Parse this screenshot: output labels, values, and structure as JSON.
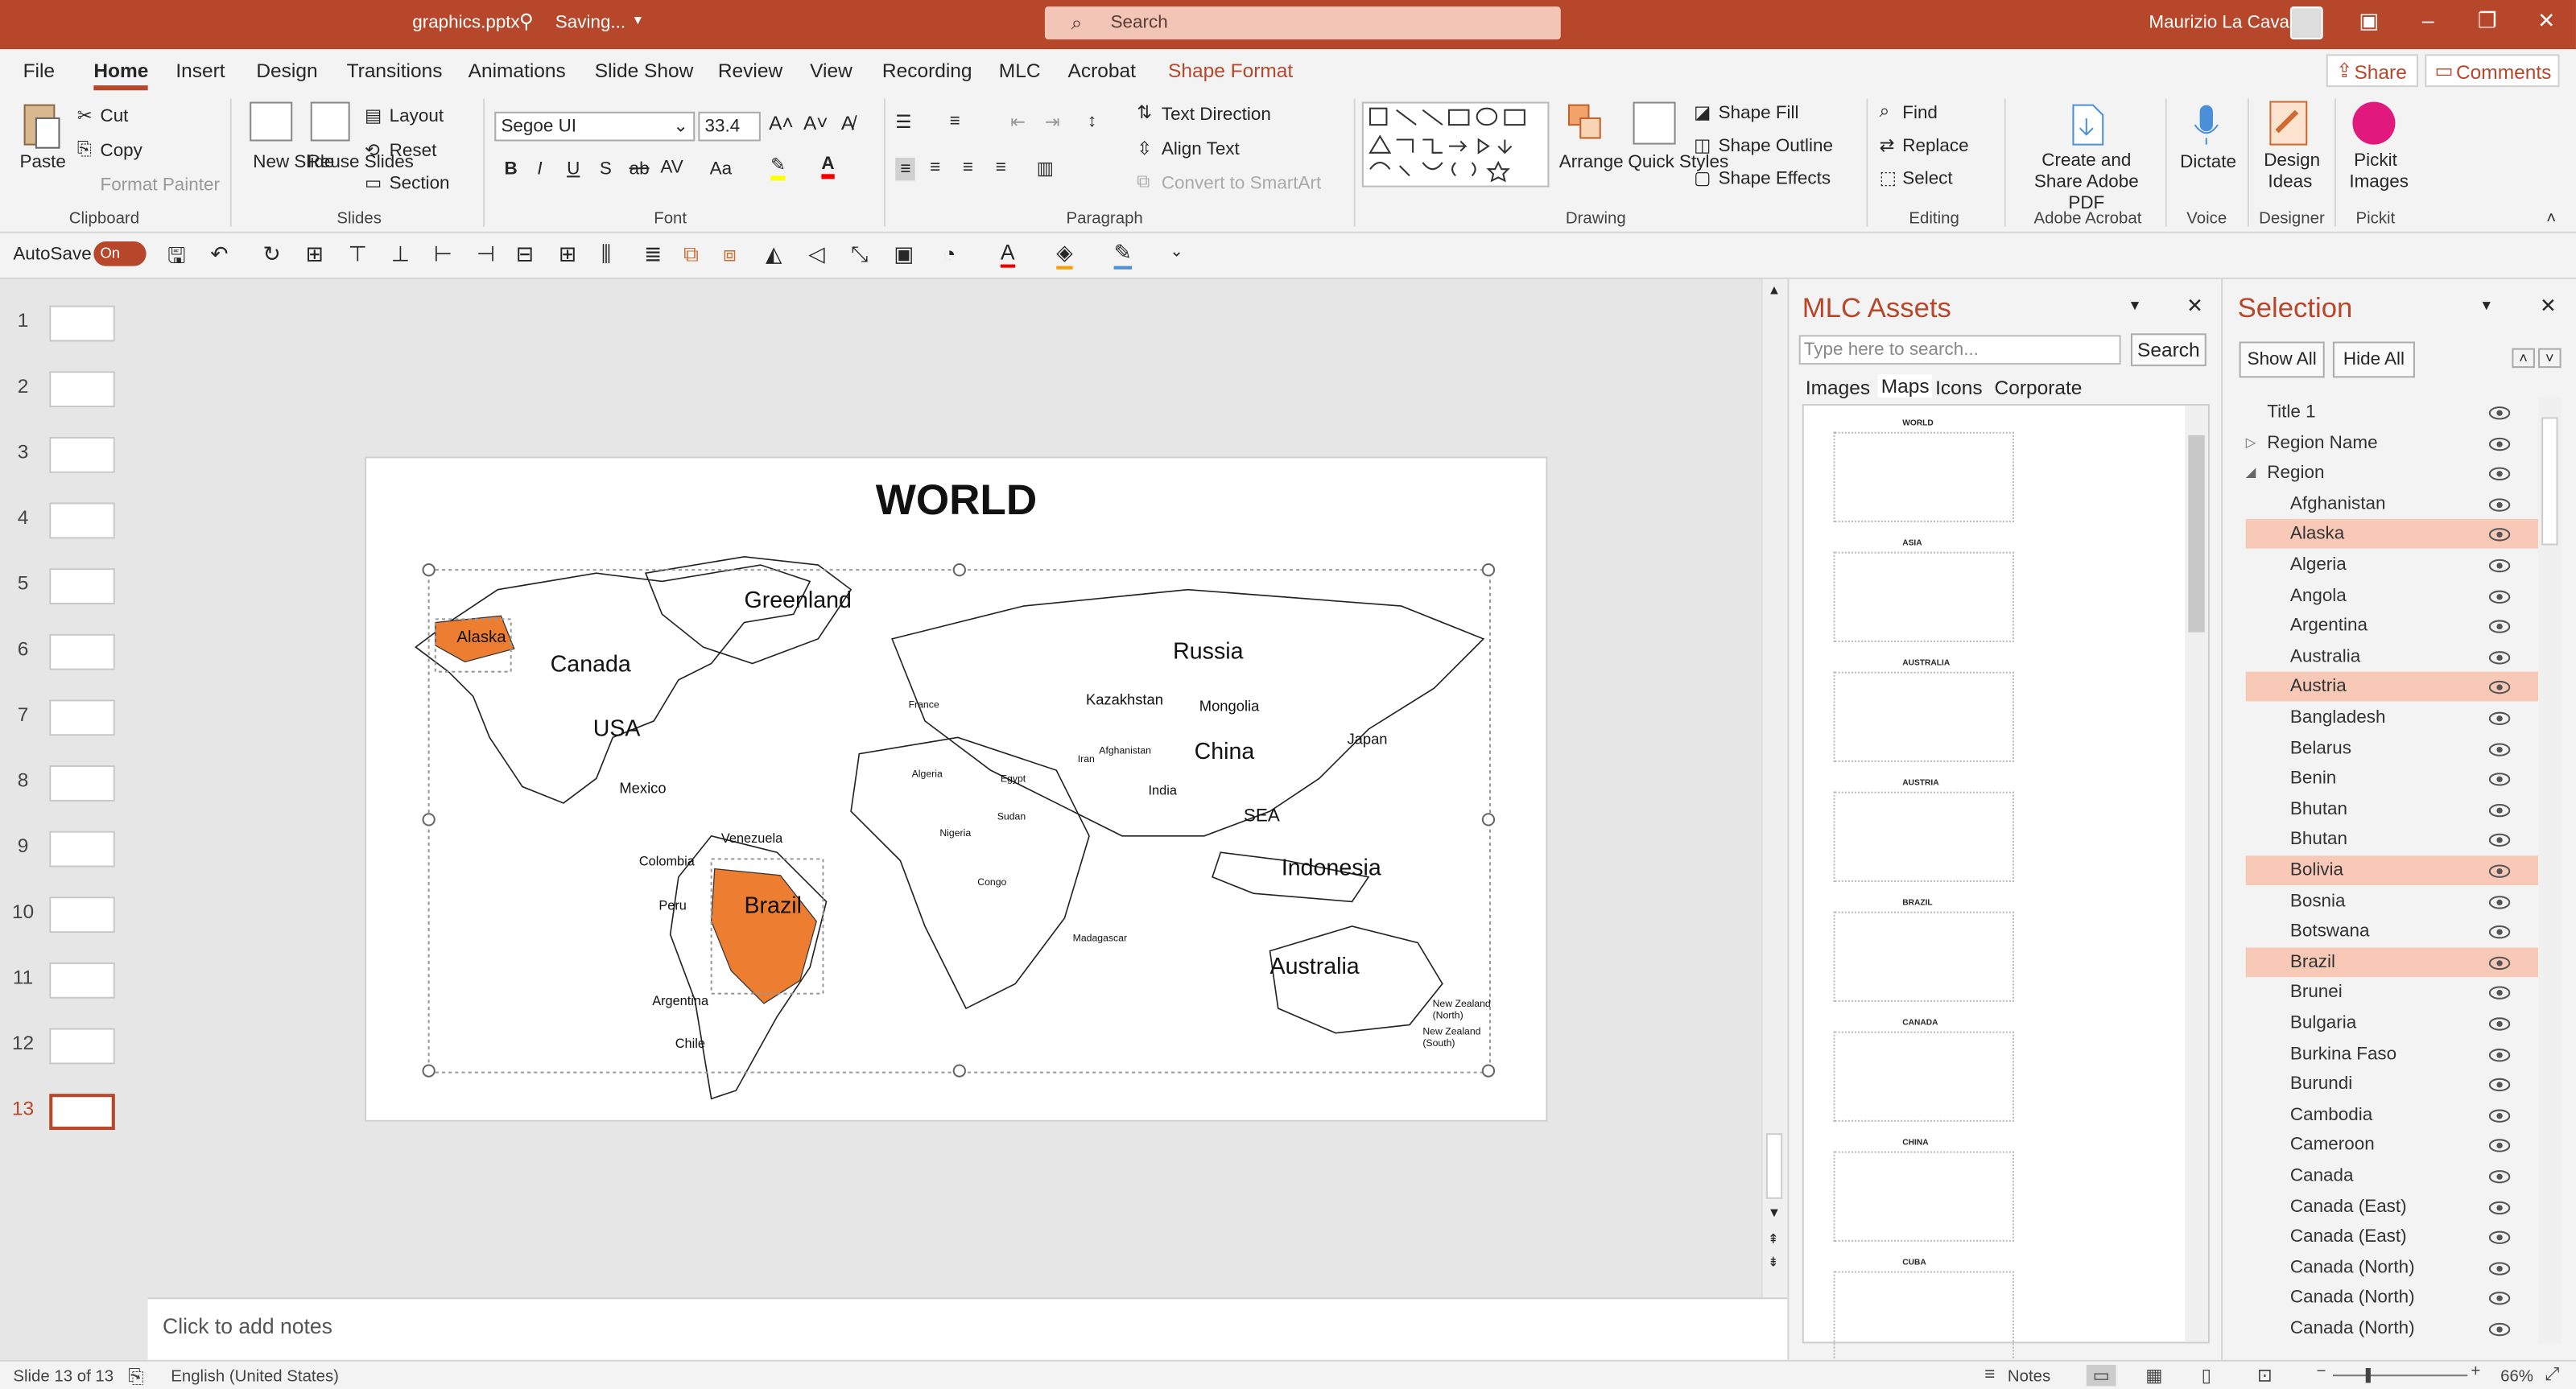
{
  "titlebar": {
    "filename": "graphics.pptx",
    "status": "Saving...",
    "search_placeholder": "Search",
    "user": "Maurizio La Cava"
  },
  "menu": {
    "tabs": [
      "File",
      "Home",
      "Insert",
      "Design",
      "Transitions",
      "Animations",
      "Slide Show",
      "Review",
      "View",
      "Recording",
      "MLC",
      "Acrobat",
      "Shape Format"
    ],
    "active": "Home",
    "share": "Share",
    "comments": "Comments"
  },
  "ribbon": {
    "clipboard": {
      "paste": "Paste",
      "cut": "Cut",
      "copy": "Copy",
      "format_painter": "Format Painter",
      "label": "Clipboard"
    },
    "slides": {
      "new_slide": "New Slide",
      "reuse_slides": "Reuse Slides",
      "layout": "Layout",
      "reset": "Reset",
      "section": "Section",
      "label": "Slides"
    },
    "font": {
      "name": "Segoe UI",
      "size": "33.4",
      "label": "Font"
    },
    "paragraph": {
      "text_direction": "Text Direction",
      "align_text": "Align Text",
      "convert": "Convert to SmartArt",
      "label": "Paragraph"
    },
    "drawing": {
      "arrange": "Arrange",
      "quick_styles": "Quick Styles",
      "shape_fill": "Shape Fill",
      "shape_outline": "Shape Outline",
      "shape_effects": "Shape Effects",
      "label": "Drawing"
    },
    "editing": {
      "find": "Find",
      "replace": "Replace",
      "select": "Select",
      "label": "Editing"
    },
    "acrobat": {
      "create_share": "Create and Share Adobe PDF",
      "label": "Adobe Acrobat"
    },
    "voice": {
      "dictate": "Dictate",
      "label": "Voice"
    },
    "designer": {
      "design_ideas": "Design Ideas",
      "label": "Designer"
    },
    "pickit": {
      "pickit_images": "Pickit Images",
      "label": "Pickit"
    }
  },
  "qat": {
    "autosave": "AutoSave",
    "toggle": "On"
  },
  "slides": {
    "numbers": [
      "1",
      "2",
      "3",
      "4",
      "5",
      "6",
      "7",
      "8",
      "9",
      "10",
      "11",
      "12",
      "13"
    ],
    "current": "13"
  },
  "slide": {
    "title": "WORLD",
    "labels": {
      "alaska": "Alaska",
      "canada": "Canada",
      "greenland": "Greenland",
      "usa": "USA",
      "mexico": "Mexico",
      "russia": "Russia",
      "kazakhstan": "Kazakhstan",
      "mongolia": "Mongolia",
      "china": "China",
      "japan": "Japan",
      "india": "India",
      "sea": "SEA",
      "indonesia": "Indonesia",
      "australia": "Australia",
      "nz_north": "New Zealand (North)",
      "nz_south": "New Zealand (South)",
      "venezuela": "Venezuela",
      "colombia": "Colombia",
      "peru": "Peru",
      "brazil": "Brazil",
      "argentina": "Argentina",
      "chile": "Chile",
      "madagascar": "Madagascar",
      "france": "France",
      "egypt": "Egypt",
      "sudan": "Sudan",
      "algeria": "Algeria",
      "nigeria": "Nigeria",
      "congo": "Congo",
      "afghanistan": "Afghanistan",
      "iran": "Iran"
    },
    "highlight_color": "#ed7d31"
  },
  "notes": {
    "placeholder": "Click to add notes"
  },
  "mlc": {
    "title": "MLC Assets",
    "search_placeholder": "Type here to search...",
    "search_button": "Search",
    "tabs": [
      "Images",
      "Maps",
      "Icons",
      "Corporate"
    ],
    "active_tab": "Maps",
    "maps": [
      "WORLD",
      "ASIA",
      "AUSTRALIA",
      "AUSTRIA",
      "BRAZIL",
      "CANADA",
      "CHINA",
      "CUBA"
    ]
  },
  "selection": {
    "title": "Selection",
    "show_all": "Show All",
    "hide_all": "Hide All",
    "items": [
      {
        "name": "Title 1",
        "level": 0,
        "hl": false
      },
      {
        "name": "Region Name",
        "level": 0,
        "hl": false
      },
      {
        "name": "Region",
        "level": 0,
        "hl": false
      },
      {
        "name": "Afghanistan",
        "level": 1,
        "hl": false
      },
      {
        "name": "Alaska",
        "level": 1,
        "hl": true
      },
      {
        "name": "Algeria",
        "level": 1,
        "hl": false
      },
      {
        "name": "Angola",
        "level": 1,
        "hl": false
      },
      {
        "name": "Argentina",
        "level": 1,
        "hl": false
      },
      {
        "name": "Australia",
        "level": 1,
        "hl": false
      },
      {
        "name": "Austria",
        "level": 1,
        "hl": true
      },
      {
        "name": "Bangladesh",
        "level": 1,
        "hl": false
      },
      {
        "name": "Belarus",
        "level": 1,
        "hl": false
      },
      {
        "name": "Benin",
        "level": 1,
        "hl": false
      },
      {
        "name": "Bhutan",
        "level": 1,
        "hl": false
      },
      {
        "name": "Bhutan",
        "level": 1,
        "hl": false
      },
      {
        "name": "Bolivia",
        "level": 1,
        "hl": true
      },
      {
        "name": "Bosnia",
        "level": 1,
        "hl": false
      },
      {
        "name": "Botswana",
        "level": 1,
        "hl": false
      },
      {
        "name": "Brazil",
        "level": 1,
        "hl": true
      },
      {
        "name": "Brunei",
        "level": 1,
        "hl": false
      },
      {
        "name": "Bulgaria",
        "level": 1,
        "hl": false
      },
      {
        "name": "Burkina Faso",
        "level": 1,
        "hl": false
      },
      {
        "name": "Burundi",
        "level": 1,
        "hl": false
      },
      {
        "name": "Cambodia",
        "level": 1,
        "hl": false
      },
      {
        "name": "Cameroon",
        "level": 1,
        "hl": false
      },
      {
        "name": "Canada",
        "level": 1,
        "hl": false
      },
      {
        "name": "Canada (East)",
        "level": 1,
        "hl": false
      },
      {
        "name": "Canada (East)",
        "level": 1,
        "hl": false
      },
      {
        "name": "Canada (North)",
        "level": 1,
        "hl": false
      },
      {
        "name": "Canada (North)",
        "level": 1,
        "hl": false
      },
      {
        "name": "Canada (North)",
        "level": 1,
        "hl": false
      }
    ]
  },
  "status": {
    "slide": "Slide 13 of 13",
    "language": "English (United States)",
    "notes": "Notes",
    "zoom": "66%"
  }
}
